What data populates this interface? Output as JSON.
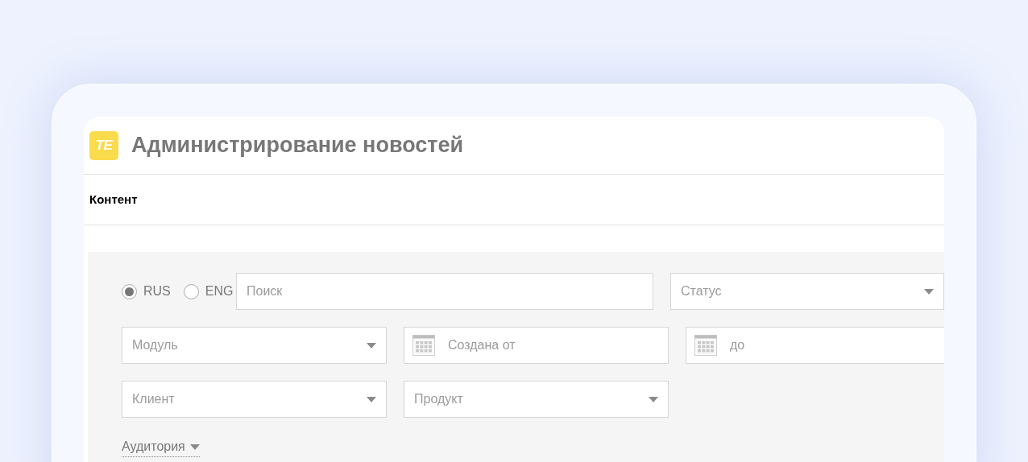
{
  "header": {
    "logo_text": "TE",
    "title": "Администрирование новостей"
  },
  "tabs": [
    {
      "label": "Контент",
      "selected": true
    }
  ],
  "filters": {
    "languages": [
      {
        "label": "RUS",
        "selected": true
      },
      {
        "label": "ENG",
        "selected": false
      }
    ],
    "search": {
      "placeholder": "Поиск"
    },
    "fields": [
      {
        "kind": "select",
        "placeholder": "Статус"
      },
      {
        "kind": "select",
        "placeholder": "Модуль"
      },
      {
        "kind": "date",
        "placeholder": "Создана от"
      },
      {
        "kind": "date",
        "placeholder": "до"
      },
      {
        "kind": "select",
        "placeholder": "Клиент"
      },
      {
        "kind": "select",
        "placeholder": "Продукт"
      }
    ],
    "audience_toggle": {
      "label": "Аудитория",
      "expanded": false
    }
  }
}
